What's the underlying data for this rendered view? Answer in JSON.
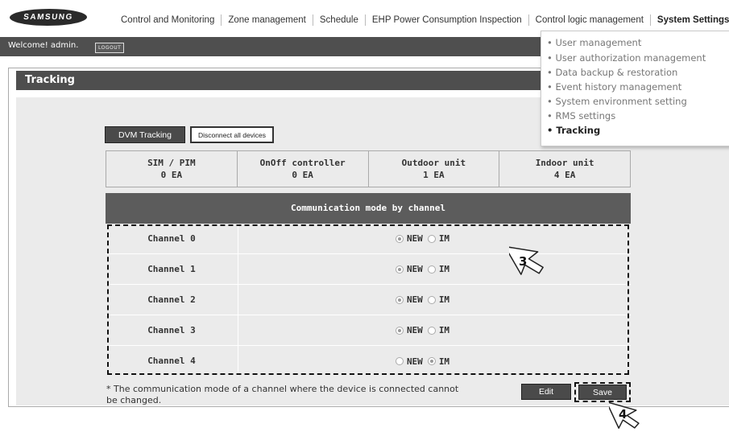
{
  "brand": {
    "logo_text": "SAMSUNG"
  },
  "nav": {
    "items": [
      "Control and Monitoring",
      "Zone management",
      "Schedule",
      "EHP Power Consumption Inspection",
      "Control logic management",
      "System Settings"
    ]
  },
  "welcome": {
    "text": "Welcome! admin.",
    "logout": "LOGOUT"
  },
  "page": {
    "title": "Tracking"
  },
  "toolbar": {
    "dvm_tracking": "DVM Tracking",
    "disconnect_all": "Disconnect all devices"
  },
  "summary": [
    {
      "label": "SIM / PIM",
      "value": "0 EA"
    },
    {
      "label": "OnOff controller",
      "value": "0 EA"
    },
    {
      "label": "Outdoor unit",
      "value": "1 EA"
    },
    {
      "label": "Indoor unit",
      "value": "4 EA"
    }
  ],
  "comm": {
    "header": "Communication mode by channel",
    "option_new": "NEW",
    "option_im": "IM",
    "channels": [
      {
        "name": "Channel 0",
        "mode": "NEW"
      },
      {
        "name": "Channel 1",
        "mode": "NEW"
      },
      {
        "name": "Channel 2",
        "mode": "NEW"
      },
      {
        "name": "Channel 3",
        "mode": "NEW"
      },
      {
        "name": "Channel 4",
        "mode": "IM"
      }
    ]
  },
  "note": "* The communication mode of a channel where the device is connected cannot be changed.",
  "actions": {
    "edit": "Edit",
    "save": "Save"
  },
  "menu": {
    "items": [
      "User management",
      "User authorization management",
      "Data backup & restoration",
      "Event history management",
      "System environment setting",
      "RMS settings",
      "Tracking"
    ],
    "active": "Tracking"
  },
  "callouts": {
    "step3": "3",
    "step4": "4"
  }
}
